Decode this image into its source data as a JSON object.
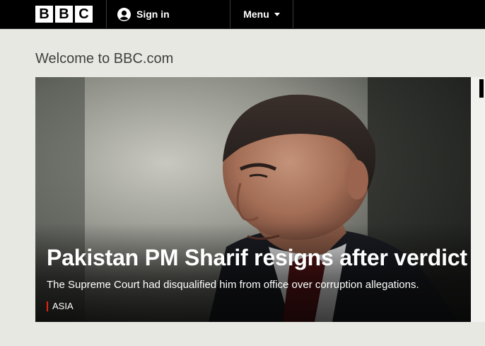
{
  "header": {
    "logo_letters": [
      "B",
      "B",
      "C"
    ],
    "sign_in_label": "Sign in",
    "menu_label": "Menu",
    "icons": {
      "account": "person-icon",
      "menu": "chevron-down-icon"
    }
  },
  "welcome_text": "Welcome to BBC.com",
  "hero": {
    "headline": "Pakistan PM Sharif resigns after verdict",
    "summary": "The Supreme Court had disqualified him from office over corruption allegations.",
    "tag": "ASIA",
    "tag_color": "#ee2211"
  },
  "colors": {
    "topbar": "#000000",
    "page_bg": "#e8e8e2"
  }
}
